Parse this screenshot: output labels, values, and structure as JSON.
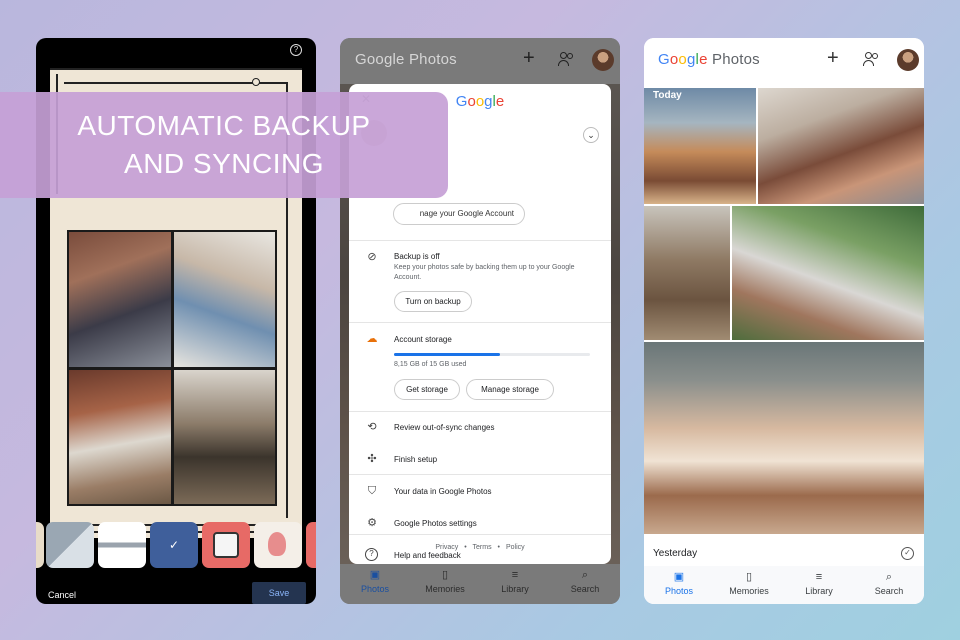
{
  "banner": {
    "line1": "AUTOMATIC BACKUP",
    "line2": "AND SYNCING"
  },
  "editor": {
    "help_icon": "?",
    "cancel_label": "Cancel",
    "save_label": "Save"
  },
  "account_sheet": {
    "app_title_1": "Google",
    "app_title_2": "Photos",
    "google_label": "Google",
    "manage_account_label": "nage your Google Account",
    "backup_title": "Backup is off",
    "backup_desc": "Keep your photos safe by backing them up to your Google Account.",
    "turn_on_backup_label": "Turn on backup",
    "storage_title": "Account storage",
    "storage_used": "8,15 GB of 15 GB used",
    "storage_fraction": 0.543,
    "get_storage_label": "Get storage",
    "manage_storage_label": "Manage storage",
    "menu": [
      {
        "label": "Review out-of-sync changes",
        "icon": "sync-icon"
      },
      {
        "label": "Finish setup",
        "icon": "pinwheel-icon"
      },
      {
        "label": "Your data in Google Photos",
        "icon": "shield-icon"
      },
      {
        "label": "Google Photos settings",
        "icon": "gear-icon"
      },
      {
        "label": "Help and feedback",
        "icon": "help-icon"
      }
    ],
    "footer": {
      "privacy": "Privacy",
      "terms": "Terms",
      "policy": "Policy",
      "sep": "•"
    }
  },
  "nav": [
    {
      "label": "Photos",
      "icon": "photo-icon"
    },
    {
      "label": "Memories",
      "icon": "memories-icon"
    },
    {
      "label": "Library",
      "icon": "library-icon"
    },
    {
      "label": "Search",
      "icon": "search-icon"
    }
  ],
  "photos_app": {
    "title_1": "Google",
    "title_2": "Photos",
    "today_label": "Today",
    "yesterday_label": "Yesterday"
  },
  "colors": {
    "blue": "#4285f4",
    "red": "#ea4335",
    "yellow": "#fbbc05",
    "green": "#34a853",
    "accent": "#1a73e8",
    "banner": "#c6a0d6"
  }
}
